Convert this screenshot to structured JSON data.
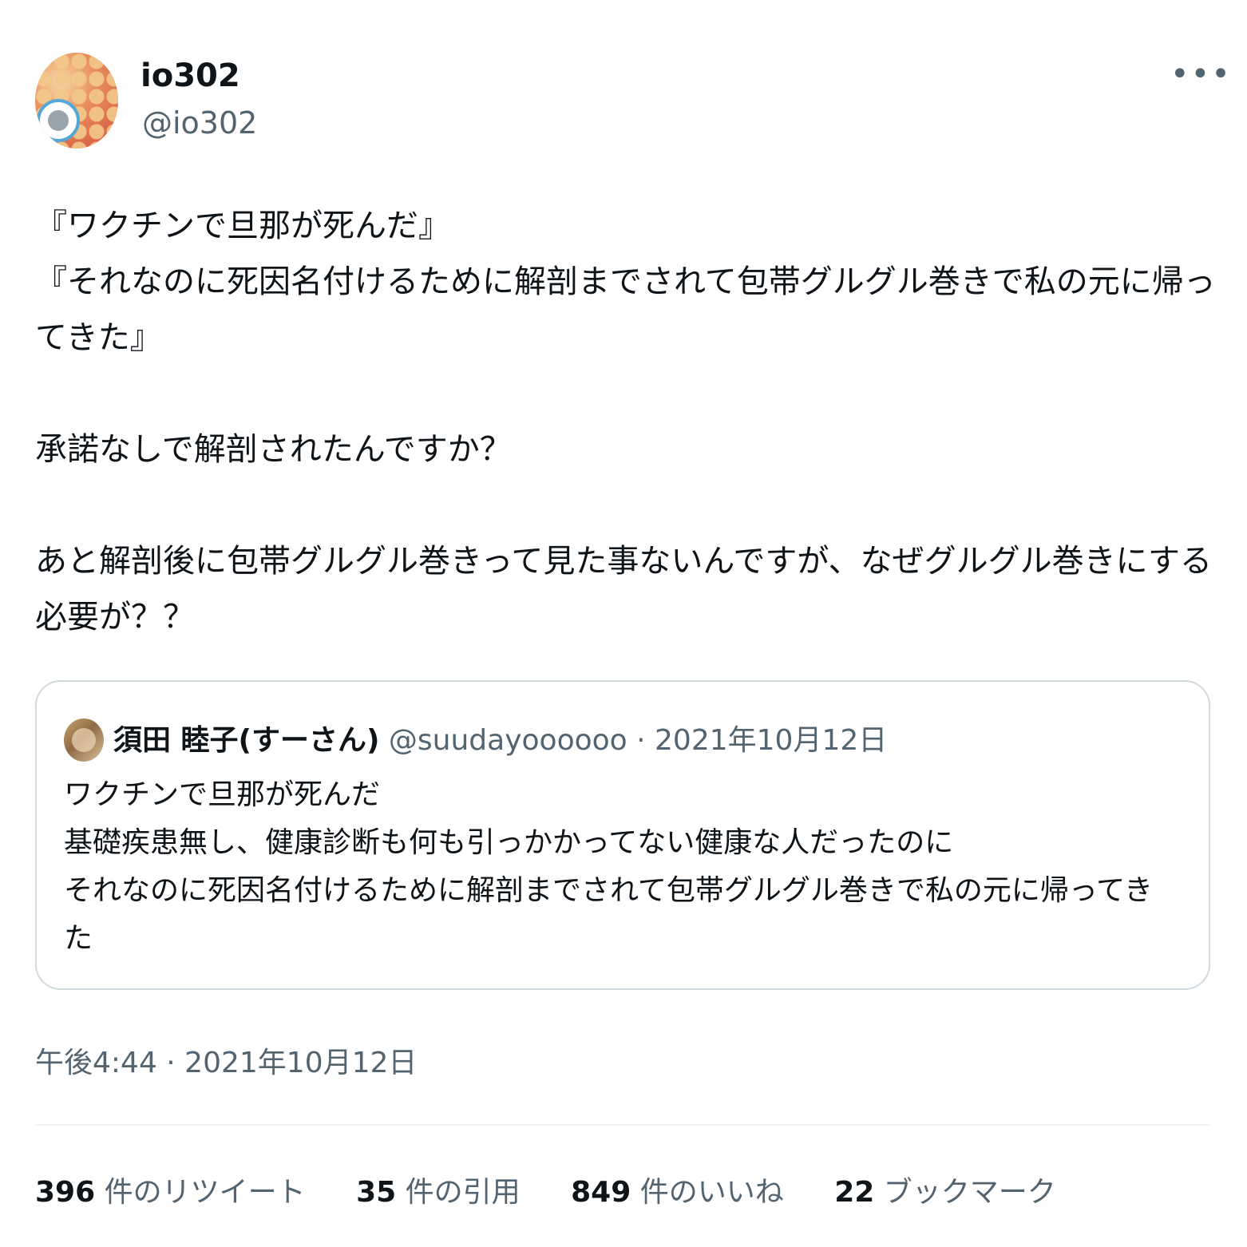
{
  "author": {
    "display_name": "io302",
    "handle": "@io302",
    "avatar_icon": "profile-photo-icon"
  },
  "more_icon": "•••",
  "body": "『ワクチンで旦那が死んだ』\n『それなのに死因名付けるために解剖までされて包帯グルグル巻きで私の元に帰ってきた』\n\n承諾なしで解剖されたんですか？\n\nあと解剖後に包帯グルグル巻きって見た事ないんですが、なぜグルグル巻きにする必要が？？",
  "quoted": {
    "display_name": "須田 睦子(すーさん)",
    "handle": "@suudayoooooo",
    "separator": "·",
    "date": "2021年10月12日",
    "text": "ワクチンで旦那が死んだ\n基礎疾患無し、健康診断も何も引っかかってない健康な人だったのに\nそれなのに死因名付けるために解剖までされて包帯グルグル巻きで私の元に帰ってきた"
  },
  "timestamp": "午後4:44 · 2021年10月12日",
  "stats": {
    "retweets": {
      "count": "396",
      "label": "件のリツイート"
    },
    "quotes": {
      "count": "35",
      "label": "件の引用"
    },
    "likes": {
      "count": "849",
      "label": "件のいいね"
    },
    "bookmarks": {
      "count": "22",
      "label": "ブックマーク"
    }
  },
  "colors": {
    "text": "#0f1419",
    "secondary": "#536471",
    "border": "#cfd9de"
  }
}
